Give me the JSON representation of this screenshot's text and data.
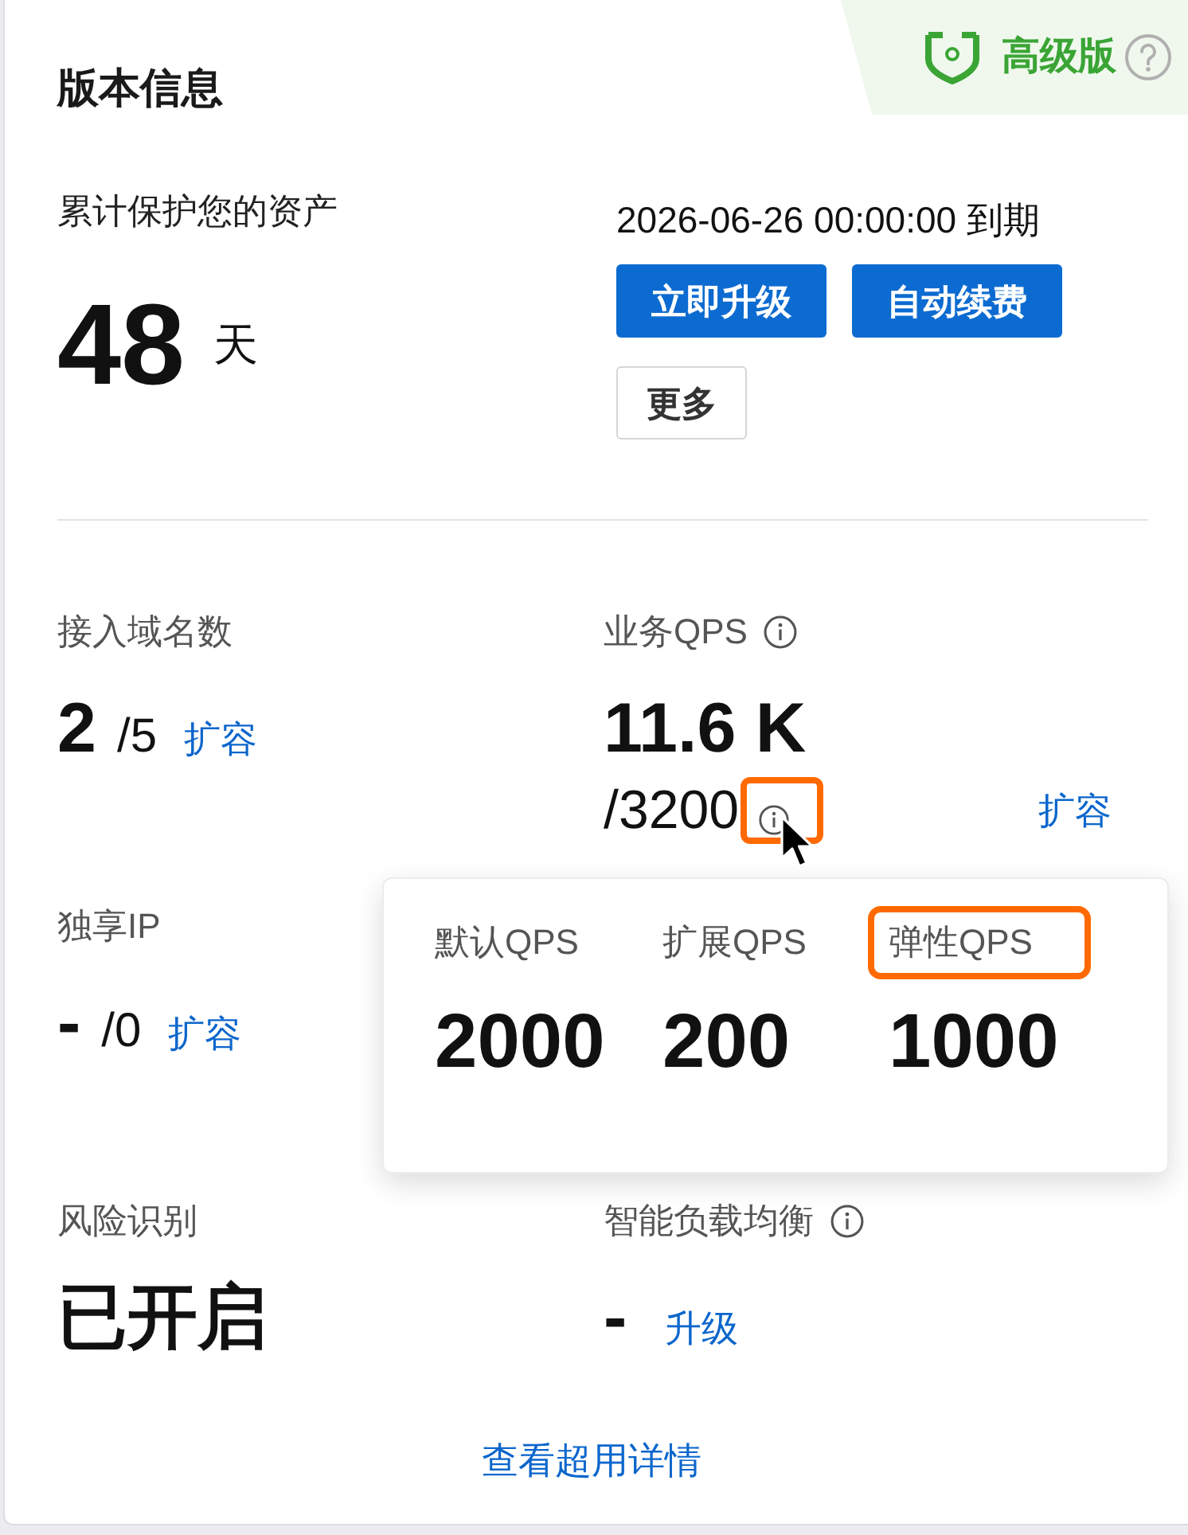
{
  "card": {
    "title": "版本信息"
  },
  "edition_badge": {
    "label": "高级版"
  },
  "protection": {
    "label": "累计保护您的资产",
    "value": "48",
    "unit": "天"
  },
  "expiry": {
    "text": "2026-06-26 00:00:00 到期"
  },
  "buttons": [
    {
      "label": "立即升级",
      "kind": "primary"
    },
    {
      "label": "自动续费",
      "kind": "primary"
    },
    {
      "label": "更多",
      "kind": "default"
    }
  ],
  "metric_rows": [
    [
      {
        "kind": "inline",
        "label": "接入域名数",
        "info": false,
        "value": "2",
        "limit": "/5",
        "link": "扩容"
      },
      {
        "kind": "stacked",
        "label": "业务QPS",
        "info": true,
        "value": "11.6 K",
        "limit": "/3200",
        "limit_info": {
          "highlighted": true
        },
        "link": "扩容"
      }
    ],
    [
      {
        "kind": "inline",
        "label": "独享IP",
        "info": false,
        "value": "-",
        "limit": "/0",
        "link": "扩容"
      }
    ],
    [
      {
        "kind": "inline",
        "label": "风险识别",
        "info": false,
        "value": "已开启"
      },
      {
        "kind": "inline",
        "label": "智能负载均衡",
        "info": true,
        "value": "-",
        "link": "升级"
      }
    ]
  ],
  "qps_popover": {
    "items": [
      {
        "label": "默认QPS",
        "value": "2000",
        "highlighted": false
      },
      {
        "label": "扩展QPS",
        "value": "200",
        "highlighted": false
      },
      {
        "label": "弹性QPS",
        "value": "1000",
        "highlighted": true
      }
    ]
  },
  "footer_link": "查看超用详情"
}
